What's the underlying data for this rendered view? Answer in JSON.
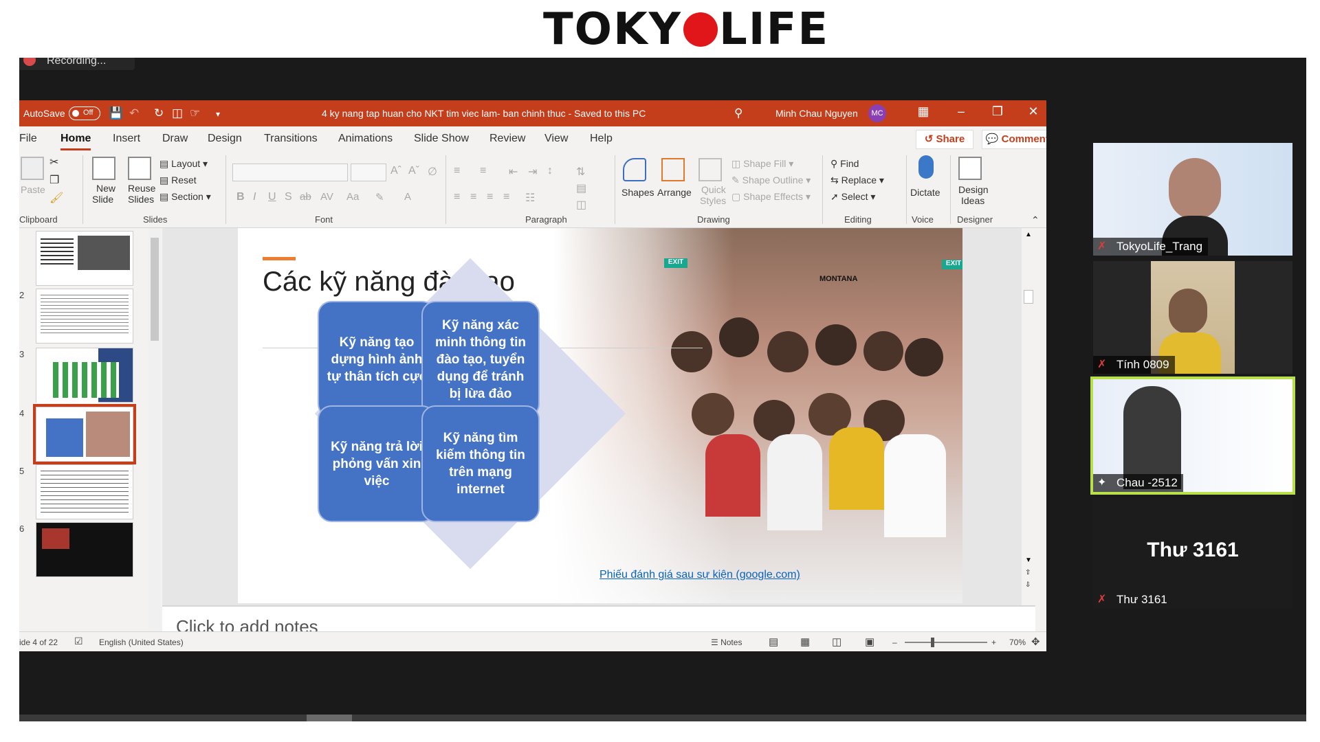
{
  "brand": {
    "left": "TOKY",
    "right": "LIFE"
  },
  "meeting": {
    "recording_label": "Recording..."
  },
  "ppt": {
    "autosave_label": "AutoSave",
    "autosave_state": "Off",
    "doc_title": "4 ky nang tap huan cho NKT tim viec lam- ban chinh thuc  -  Saved to this PC",
    "user_name": "Minh Chau Nguyen",
    "user_initials": "MC",
    "tabs": [
      "File",
      "Home",
      "Insert",
      "Draw",
      "Design",
      "Transitions",
      "Animations",
      "Slide Show",
      "Review",
      "View",
      "Help"
    ],
    "active_tab": "Home",
    "share_label": "Share",
    "comments_label": "Comments",
    "ribbon": {
      "paste": "Paste",
      "new_slide": "New\nSlide",
      "new_slide_line1": "New",
      "new_slide_line2": "Slide",
      "reuse_line1": "Reuse",
      "reuse_line2": "Slides",
      "layout": "Layout",
      "reset": "Reset",
      "section": "Section",
      "shapes": "Shapes",
      "arrange": "Arrange",
      "quick_styles_line1": "Quick",
      "quick_styles_line2": "Styles",
      "shape_fill": "Shape Fill",
      "shape_outline": "Shape Outline",
      "shape_effects": "Shape Effects",
      "find": "Find",
      "replace": "Replace",
      "select": "Select",
      "dictate": "Dictate",
      "design_ideas_line1": "Design",
      "design_ideas_line2": "Ideas",
      "groups": {
        "clipboard": "Clipboard",
        "slides": "Slides",
        "font": "Font",
        "paragraph": "Paragraph",
        "drawing": "Drawing",
        "editing": "Editing",
        "voice": "Voice",
        "designer": "Designer"
      }
    },
    "thumbnails": [
      "2",
      "3",
      "4",
      "5",
      "6"
    ],
    "slide": {
      "title": "Các kỹ năng đào tạo",
      "skills": [
        "Kỹ năng tạo dựng hình ảnh tự thân tích cực",
        "Kỹ năng xác minh thông tin đào tạo, tuyển dụng để tránh bị lừa đảo",
        "Kỹ năng trả lời phỏng vấn xin việc",
        "Kỹ năng tìm kiếm thông tin trên mạng internet"
      ],
      "link_text": "Phiếu đánh giá sau sự kiện (google.com)",
      "exit_sign": "EXIT",
      "photo_logo": "MONTANA"
    },
    "notes_placeholder": "Click to add notes",
    "status": {
      "slide_count": "ide 4 of 22",
      "language": "English (United States)",
      "notes_label": "Notes",
      "zoom": "70%"
    }
  },
  "participants": [
    {
      "name": "TokyoLife_Trang"
    },
    {
      "name": "Tính 0809"
    },
    {
      "name": "Chau -2512"
    },
    {
      "name": "Thư 3161",
      "display": "Thư 3161"
    }
  ],
  "colors": {
    "ppt_accent": "#c43e1c",
    "skill_box": "#4472c4",
    "brand_red": "#e0161b"
  }
}
